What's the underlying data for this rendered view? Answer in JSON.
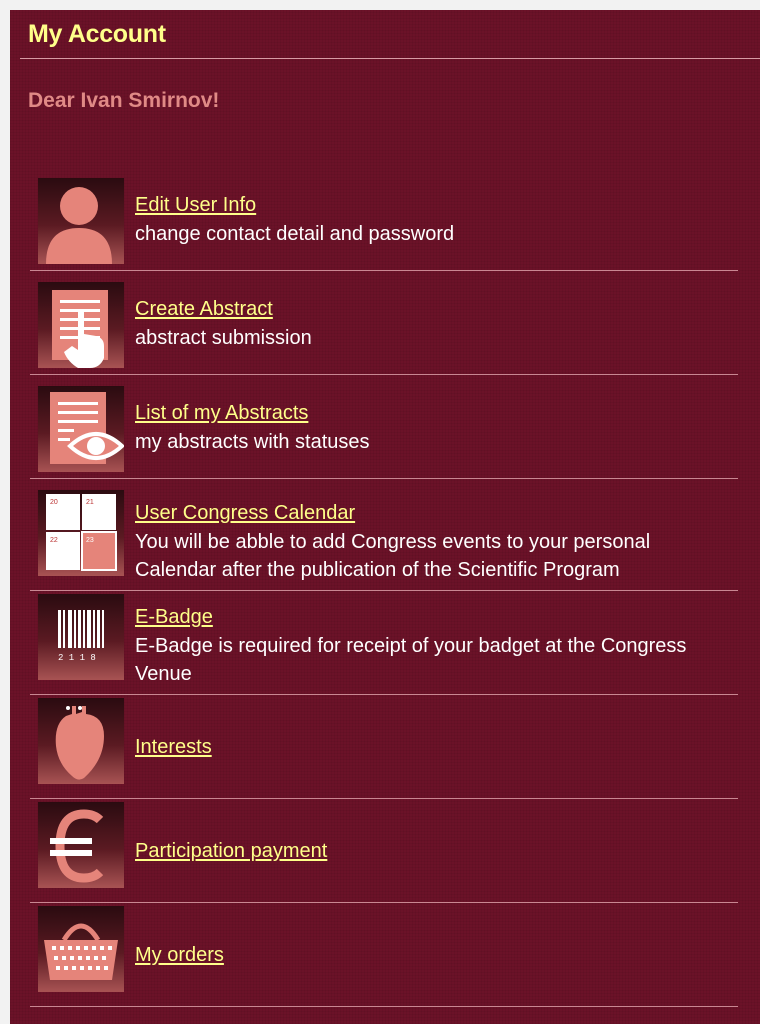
{
  "header": {
    "title": "My Account"
  },
  "greeting": "Dear Ivan Smirnov!",
  "colors": {
    "background": "#6b1228",
    "link": "#ffff8a",
    "greeting": "#e08a86",
    "text": "#ffffff"
  },
  "items": [
    {
      "icon": "user-icon",
      "label": "Edit User Info",
      "description": "change contact detail and password"
    },
    {
      "icon": "document-touch-icon",
      "label": "Create Abstract",
      "description": "abstract submission"
    },
    {
      "icon": "document-eye-icon",
      "label": "List of my Abstracts",
      "description": "my abstracts with statuses"
    },
    {
      "icon": "calendar-icon",
      "label": "User Congress Calendar",
      "description": "You will be abble to add Congress events to your personal Calendar after the publication of the Scientific Program",
      "calendar_days": [
        "20",
        "21",
        "22",
        "23"
      ]
    },
    {
      "icon": "barcode-icon",
      "label": "E-Badge",
      "description": "E-Badge is required for receipt of your badget at the Congress Venue",
      "barcode_number": "2 1 1 8"
    },
    {
      "icon": "heart-icon",
      "label": "Interests"
    },
    {
      "icon": "euro-icon",
      "label": "Participation payment"
    },
    {
      "icon": "basket-icon",
      "label": "My orders"
    }
  ]
}
